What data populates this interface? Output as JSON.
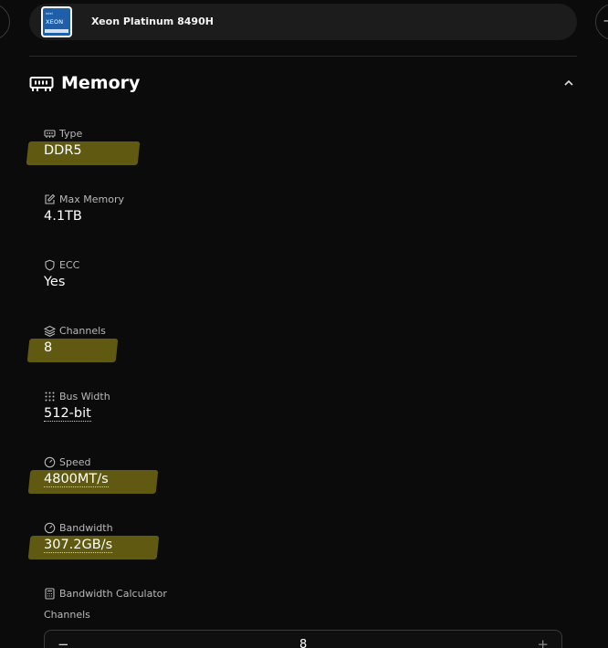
{
  "processor": {
    "name": "Xeon Platinum 8490H",
    "logo_text": [
      "intel",
      "XEON"
    ]
  },
  "nav": {
    "prev_icon": "chevron-left-icon",
    "next_icon": "chevron-right-icon"
  },
  "memory": {
    "title": "Memory",
    "specs": [
      {
        "label": "Type",
        "value": "DDR5",
        "icon": "memory-chip-icon",
        "highlighted": true
      },
      {
        "label": "Max Memory",
        "value": "4.1TB",
        "icon": "edit-icon",
        "highlighted": false
      },
      {
        "label": "ECC",
        "value": "Yes",
        "icon": "shield-icon",
        "highlighted": false
      },
      {
        "label": "Channels",
        "value": "8",
        "icon": "layers-icon",
        "highlighted": true
      },
      {
        "label": "Bus Width",
        "value": "512-bit",
        "icon": "grid-dots-icon",
        "highlighted": false
      },
      {
        "label": "Speed",
        "value": "4800MT/s",
        "icon": "gauge-icon",
        "highlighted": true
      },
      {
        "label": "Bandwidth",
        "value": "307.2GB/s",
        "icon": "gauge-icon",
        "highlighted": true
      }
    ],
    "calculator": {
      "label": "Bandwidth Calculator",
      "channels_label": "Channels",
      "channels_value": "8",
      "minus": "−",
      "plus": "+"
    }
  },
  "colors": {
    "background": "#0b0b0b",
    "highlight": "#5f5911",
    "pill": "#1c1c1c"
  }
}
